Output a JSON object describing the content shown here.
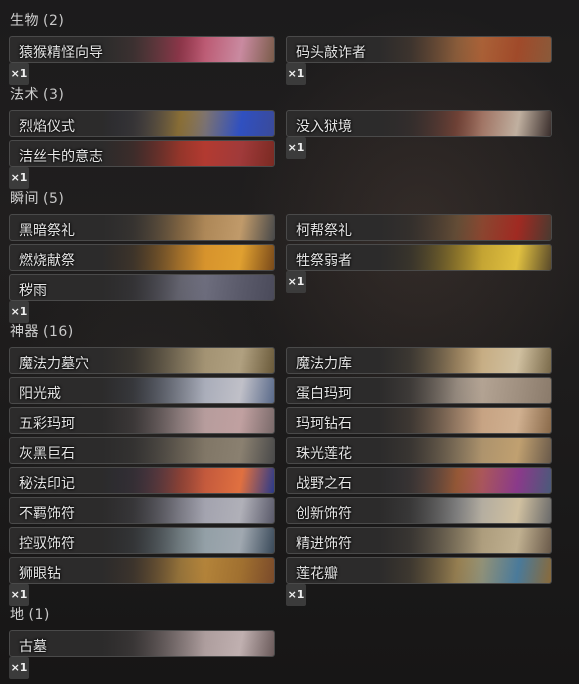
{
  "sections": [
    {
      "title": "生物",
      "count": "(2)",
      "cards": [
        {
          "name": "猿猴精怪向导",
          "qty": "×1",
          "art": [
            "#7a5c4a",
            "#b33a55",
            "#c98aa0"
          ]
        },
        {
          "name": "码头敲诈者",
          "qty": "×1",
          "art": [
            "#8a5a3a",
            "#b07040",
            "#a04a2a"
          ]
        }
      ]
    },
    {
      "title": "法术",
      "count": "(3)",
      "cards": [
        {
          "name": "烈焰仪式",
          "qty": "",
          "art": [
            "#3a4a9a",
            "#b08a3a",
            "#3050c0"
          ]
        },
        {
          "name": "没入狱境",
          "qty": "×1",
          "art": [
            "#3a2e2c",
            "#8a4a3a",
            "#c0b0a0"
          ]
        },
        {
          "name": "洁丝卡的意志",
          "qty": "×1",
          "art": [
            "#7a2a22",
            "#c03a2a",
            "#a03a3a"
          ]
        }
      ]
    },
    {
      "title": "瞬间",
      "count": "(5)",
      "cards": [
        {
          "name": "黑暗祭礼",
          "qty": "",
          "art": [
            "#4a4a4a",
            "#a07a4a",
            "#c09a6a"
          ]
        },
        {
          "name": "柯帮祭礼",
          "qty": "",
          "art": [
            "#4a3a30",
            "#7a5a3a",
            "#a02a22"
          ]
        },
        {
          "name": "燃烧献祭",
          "qty": "",
          "art": [
            "#7a4a1a",
            "#d08a2a",
            "#e0a030"
          ]
        },
        {
          "name": "牲祭弱者",
          "qty": "×1",
          "art": [
            "#5a4a2a",
            "#b0902a",
            "#e0c040"
          ]
        },
        {
          "name": "秽雨",
          "qty": "×1",
          "art": [
            "#4a4a5a",
            "#7a7a8a",
            "#5a5a6a"
          ]
        }
      ]
    },
    {
      "title": "神器",
      "count": "(16)",
      "cards": [
        {
          "name": "魔法力墓穴",
          "qty": "",
          "art": [
            "#6a5a3a",
            "#9a8a6a",
            "#b0a080"
          ]
        },
        {
          "name": "魔法力库",
          "qty": "",
          "art": [
            "#7a6a4a",
            "#c0a070",
            "#d0c0a0"
          ]
        },
        {
          "name": "阳光戒",
          "qty": "",
          "art": [
            "#5a6a8a",
            "#9aa0b0",
            "#c0c0c8"
          ]
        },
        {
          "name": "蛋白玛珂",
          "qty": "",
          "art": [
            "#8a7a6a",
            "#c0b0a0",
            "#a09080"
          ]
        },
        {
          "name": "五彩玛珂",
          "qty": "",
          "art": [
            "#7a6a6a",
            "#b09a9a",
            "#c0a0a0"
          ]
        },
        {
          "name": "玛珂钻石",
          "qty": "",
          "art": [
            "#8a6a4a",
            "#c09a7a",
            "#d0b090"
          ]
        },
        {
          "name": "灰黑巨石",
          "qty": "",
          "art": [
            "#4a4a4a",
            "#7a7060",
            "#8a8070"
          ]
        },
        {
          "name": "珠光莲花",
          "qty": "",
          "art": [
            "#6a5a4a",
            "#a08a6a",
            "#c0a070"
          ]
        },
        {
          "name": "秘法印记",
          "qty": "",
          "art": [
            "#2a3a8a",
            "#b04a3a",
            "#e07040"
          ]
        },
        {
          "name": "战野之石",
          "qty": "",
          "art": [
            "#4a5a7a",
            "#c06a3a",
            "#8a3a8a"
          ]
        },
        {
          "name": "不羁饰符",
          "qty": "",
          "art": [
            "#5a5a6a",
            "#9a9aa8",
            "#b0b0b8"
          ]
        },
        {
          "name": "创新饰符",
          "qty": "",
          "art": [
            "#6a6a6a",
            "#a0a0a0",
            "#d0c0a0"
          ]
        },
        {
          "name": "控驭饰符",
          "qty": "",
          "art": [
            "#3a4a5a",
            "#8a9aa0",
            "#a0a8b0"
          ]
        },
        {
          "name": "精进饰符",
          "qty": "",
          "art": [
            "#6a5a4a",
            "#a09070",
            "#c0b090"
          ]
        },
        {
          "name": "狮眼钻",
          "qty": "×1",
          "art": [
            "#7a4a2a",
            "#c09040",
            "#a07030"
          ]
        },
        {
          "name": "莲花瓣",
          "qty": "×1",
          "art": [
            "#8a6a3a",
            "#c0a060",
            "#4a7a9a"
          ]
        }
      ]
    },
    {
      "title": "地",
      "count": "(1)",
      "cards": [
        {
          "name": "古墓",
          "qty": "×1",
          "art": [
            "#6a5a5a",
            "#a09090",
            "#c0b0b0"
          ]
        }
      ]
    }
  ]
}
